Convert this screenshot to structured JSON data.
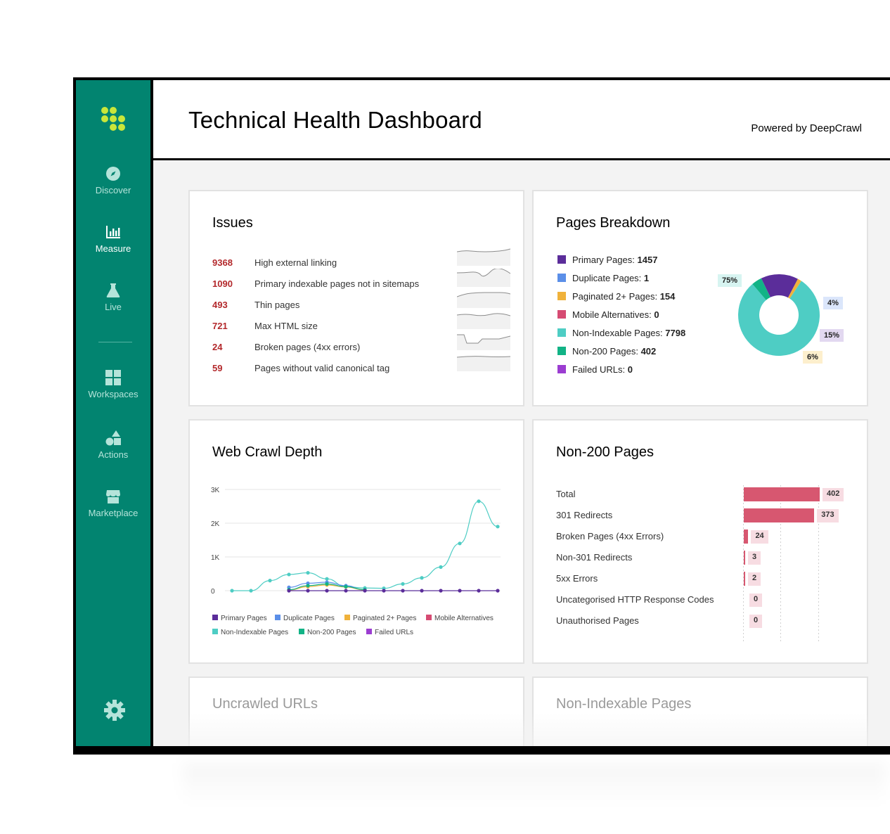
{
  "header": {
    "title": "Technical Health Dashboard",
    "powered_by": "Powered by DeepCrawl"
  },
  "sidebar": {
    "items": [
      {
        "label": "Discover",
        "icon": "compass-icon"
      },
      {
        "label": "Measure",
        "icon": "bar-chart-icon",
        "active": true
      },
      {
        "label": "Live",
        "icon": "flask-icon"
      },
      {
        "label": "Workspaces",
        "icon": "grid-icon"
      },
      {
        "label": "Actions",
        "icon": "shapes-icon"
      },
      {
        "label": "Marketplace",
        "icon": "store-icon"
      }
    ],
    "settings_icon": "gear-icon"
  },
  "issues": {
    "title": "Issues",
    "rows": [
      {
        "count": "9368",
        "label": "High external linking"
      },
      {
        "count": "1090",
        "label": "Primary indexable pages not in sitemaps"
      },
      {
        "count": "493",
        "label": "Thin pages"
      },
      {
        "count": "721",
        "label": "Max HTML size"
      },
      {
        "count": "24",
        "label": "Broken pages (4xx errors)"
      },
      {
        "count": "59",
        "label": "Pages without valid canonical tag"
      }
    ]
  },
  "pages_breakdown": {
    "title": "Pages Breakdown",
    "legend": [
      {
        "label": "Primary Pages:",
        "value": "1457",
        "color": "#5b2d9a"
      },
      {
        "label": "Duplicate Pages:",
        "value": "1",
        "color": "#5b8fe8"
      },
      {
        "label": "Paginated 2+ Pages:",
        "value": "154",
        "color": "#f0b23b"
      },
      {
        "label": "Mobile Alternatives:",
        "value": "0",
        "color": "#d64b73"
      },
      {
        "label": "Non-Indexable Pages:",
        "value": "7798",
        "color": "#4ecdc4"
      },
      {
        "label": "Non-200 Pages:",
        "value": "402",
        "color": "#12b386"
      },
      {
        "label": "Failed URLs:",
        "value": "0",
        "color": "#9b3dd1"
      }
    ],
    "badges": {
      "teal": "75%",
      "blue": "4%",
      "purple": "15%",
      "yellow": "6%"
    }
  },
  "crawl_depth": {
    "title": "Web Crawl Depth",
    "legend": [
      {
        "label": "Primary Pages",
        "color": "#5b2d9a"
      },
      {
        "label": "Duplicate Pages",
        "color": "#5b8fe8"
      },
      {
        "label": "Paginated 2+ Pages",
        "color": "#f0b23b"
      },
      {
        "label": "Mobile Alternatives",
        "color": "#d64b73"
      },
      {
        "label": "Non-Indexable Pages",
        "color": "#4ecdc4"
      },
      {
        "label": "Non-200 Pages",
        "color": "#12b386"
      },
      {
        "label": "Failed URLs",
        "color": "#9b3dd1"
      }
    ]
  },
  "chart_data": {
    "type": "line",
    "x": [
      1,
      2,
      3,
      4,
      5,
      6,
      7,
      8,
      9,
      10,
      11,
      12,
      13,
      14,
      15
    ],
    "ylim": [
      0,
      3000
    ],
    "yticks": [
      "0",
      "1K",
      "2K",
      "3K"
    ],
    "series": [
      {
        "name": "Non-Indexable Pages",
        "color": "#4ecdc4",
        "values": [
          0,
          0,
          300,
          480,
          530,
          350,
          120,
          80,
          70,
          200,
          380,
          700,
          1400,
          2650,
          1900
        ]
      },
      {
        "name": "Duplicate Pages",
        "color": "#5b8fe8",
        "values": [
          null,
          null,
          null,
          100,
          220,
          250,
          150,
          20,
          null,
          null,
          null,
          null,
          null,
          null,
          null
        ]
      },
      {
        "name": "Paginated 2+ Pages",
        "color": "#f0b23b",
        "values": [
          null,
          null,
          null,
          20,
          120,
          170,
          110,
          20,
          null,
          null,
          null,
          null,
          null,
          null,
          null
        ]
      },
      {
        "name": "Non-200 Pages",
        "color": "#12b386",
        "values": [
          null,
          null,
          null,
          30,
          150,
          200,
          120,
          30,
          null,
          null,
          null,
          null,
          null,
          null,
          null
        ]
      },
      {
        "name": "Primary Pages",
        "color": "#5b2d9a",
        "values": [
          null,
          null,
          null,
          0,
          0,
          0,
          0,
          0,
          0,
          0,
          0,
          0,
          0,
          0,
          0
        ]
      }
    ]
  },
  "non200": {
    "title": "Non-200 Pages",
    "rows": [
      {
        "label": "Total",
        "value": "402"
      },
      {
        "label": "301 Redirects",
        "value": "373"
      },
      {
        "label": "Broken Pages (4xx Errors)",
        "value": "24"
      },
      {
        "label": "Non-301 Redirects",
        "value": "3"
      },
      {
        "label": "5xx Errors",
        "value": "2"
      },
      {
        "label": "Uncategorised HTTP Response Codes",
        "value": "0"
      },
      {
        "label": "Unauthorised Pages",
        "value": "0"
      }
    ]
  },
  "uncrawled": {
    "title": "Uncrawled URLs"
  },
  "nonindexable": {
    "title": "Non-Indexable Pages"
  }
}
